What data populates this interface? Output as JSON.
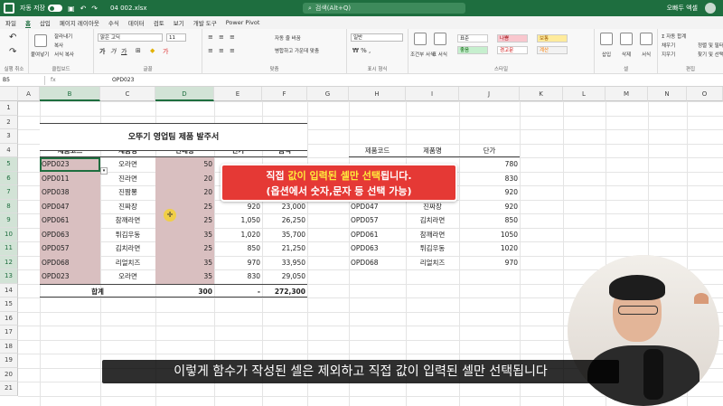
{
  "titlebar": {
    "autosave_label": "자동 저장",
    "filename": "04 002.xlsx",
    "search_placeholder": "검색(Alt+Q)",
    "user": "오빠두 엑셀"
  },
  "menu": [
    "파일",
    "홈",
    "삽입",
    "페이지 레이아웃",
    "수식",
    "데이터",
    "검토",
    "보기",
    "개발 도구",
    "Power Pivot"
  ],
  "ribbon": {
    "undo_group": "실행 취소",
    "clipboard": {
      "label": "클립보드",
      "paste": "붙여넣기",
      "cut": "잘라내기",
      "copy": "복사",
      "format_painter": "서식 복사"
    },
    "font": {
      "label": "글꼴",
      "name": "맑은 고딕",
      "size": "11"
    },
    "align": {
      "label": "맞춤",
      "wrap": "자동 줄 바꿈",
      "merge": "병합하고 가운데 맞춤"
    },
    "number": {
      "label": "표시 형식",
      "format": "일반"
    },
    "styles": {
      "label": "스타일",
      "cond": "조건부 서식",
      "table": "표 서식",
      "items": [
        "표준",
        "나쁨",
        "보통",
        "좋음",
        "경고문",
        "계산"
      ]
    },
    "cells": {
      "label": "셀",
      "insert": "삽입",
      "delete": "삭제",
      "format": "서식"
    },
    "edit": {
      "label": "편집",
      "autosum": "자동 합계",
      "fill": "채우기",
      "clear": "지우기",
      "sort": "정렬 및 필터",
      "find": "찾기 및 선택"
    }
  },
  "formula": {
    "namebox": "B5",
    "fx": "fx",
    "value": "OPD023"
  },
  "columns": [
    "A",
    "B",
    "C",
    "D",
    "E",
    "F",
    "G",
    "H",
    "I",
    "J",
    "K",
    "L",
    "M",
    "N",
    "O"
  ],
  "rows": [
    "1",
    "2",
    "3",
    "4",
    "5",
    "6",
    "7",
    "8",
    "9",
    "10",
    "11",
    "12",
    "13",
    "14",
    "15",
    "16",
    "17",
    "18",
    "19",
    "20",
    "21"
  ],
  "sheet": {
    "title": "오뚜기 영업팀 제품 발주서",
    "headers": [
      "제품코드",
      "제품명",
      "판매량",
      "단가",
      "금액"
    ],
    "data": [
      [
        "OPD023",
        "오라면",
        "50",
        "",
        ""
      ],
      [
        "OPD011",
        "진라면",
        "20",
        "",
        ""
      ],
      [
        "OPD038",
        "진짬뽕",
        "20",
        "",
        ""
      ],
      [
        "OPD047",
        "진짜장",
        "25",
        "920",
        "23,000"
      ],
      [
        "OPD061",
        "참깨라면",
        "25",
        "1,050",
        "26,250"
      ],
      [
        "OPD063",
        "튀김우동",
        "35",
        "1,020",
        "35,700"
      ],
      [
        "OPD057",
        "김치라면",
        "25",
        "850",
        "21,250"
      ],
      [
        "OPD068",
        "리얼치즈",
        "35",
        "970",
        "33,950"
      ],
      [
        "OPD023",
        "오라면",
        "35",
        "830",
        "29,050"
      ]
    ],
    "total": [
      "합계",
      "300",
      "-",
      "272,300"
    ],
    "lookup_headers": [
      "제품코드",
      "제품명",
      "단가"
    ],
    "lookup_data": [
      [
        "",
        "",
        "780"
      ],
      [
        "",
        "",
        "830"
      ],
      [
        "",
        "",
        "920"
      ],
      [
        "OPD047",
        "진짜장",
        "920"
      ],
      [
        "OPD057",
        "김치라면",
        "850"
      ],
      [
        "OPD061",
        "참깨라면",
        "1050"
      ],
      [
        "OPD063",
        "튀김우동",
        "1020"
      ],
      [
        "OPD068",
        "리얼치즈",
        "970"
      ]
    ]
  },
  "callout": {
    "line1_a": "직접 ",
    "line1_b": "값이 입력된 셀만 선택",
    "line1_c": "됩니다.",
    "line2": "(옵션에서 숫자,문자 등 선택 가능)"
  },
  "subtitle": "이렇게 함수가 작성된 셀은 제외하고 직접 값이 입력된 셀만 선택됩니다",
  "colors": {
    "excel_green": "#1e6e3f",
    "highlight": "#d9bfc0",
    "callout_red": "#e53935",
    "callout_yellow": "#ffeb3b"
  }
}
